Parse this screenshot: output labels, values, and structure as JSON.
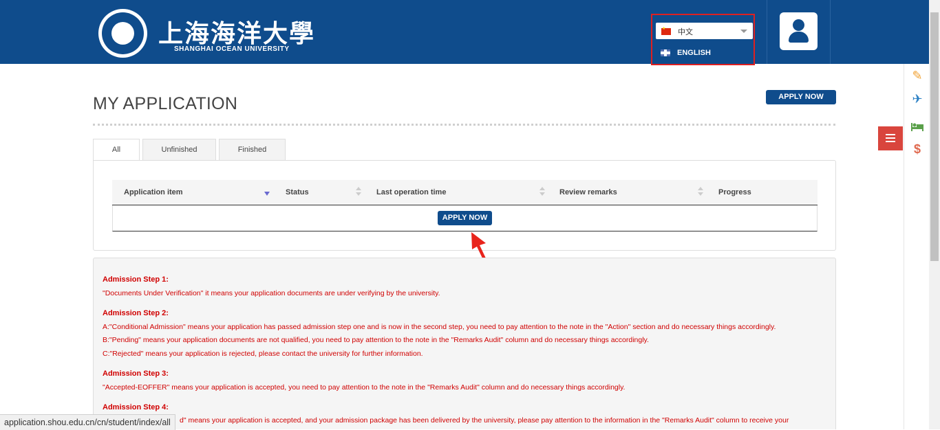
{
  "header": {
    "logo_cn": "上海海洋大學",
    "logo_en": "SHANGHAI OCEAN UNIVERSITY",
    "language": {
      "selected": "中文",
      "option": "ENGLISH"
    }
  },
  "page": {
    "title": "MY APPLICATION",
    "apply_now_label": "APPLY NOW"
  },
  "tabs": [
    {
      "label": "All",
      "active": true
    },
    {
      "label": "Unfinished",
      "active": false
    },
    {
      "label": "Finished",
      "active": false
    }
  ],
  "table": {
    "columns": [
      "Application item",
      "Status",
      "Last operation time",
      "Review remarks",
      "Progress"
    ],
    "empty_action_label": "APPLY NOW"
  },
  "info": {
    "steps": [
      {
        "title": "Admission Step 1:",
        "lines": [
          "\"Documents Under Verification\" it means your application documents are under verifying by the university."
        ]
      },
      {
        "title": "Admission Step 2:",
        "lines": [
          "A:\"Conditional Admission\" means your application has passed admission step one and is now in the second step, you need to pay attention to the note in the \"Action\" section and do necessary things accordingly.",
          "B:\"Pending\" means your application documents are not qualified, you need to pay attention to the note in the \"Remarks Audit\" column and do necessary things accordingly.",
          "C:\"Rejected\" means your application is rejected, please contact the university for further information."
        ]
      },
      {
        "title": "Admission Step 3:",
        "lines": [
          "\"Accepted-EOFFER\" means your application is accepted, you need to pay attention to the note in the \"Remarks Audit\" column and do necessary things accordingly."
        ]
      },
      {
        "title": "Admission Step 4:",
        "lines": [
          "d\" means your application is accepted, and your admission package has been delivered by the university, please pay attention to the information in the \"Remarks Audit\" column to receive your"
        ]
      }
    ]
  },
  "statusbar": {
    "url": "application.shou.edu.cn/cn/student/index/all"
  },
  "colors": {
    "header_bg": "#0f4c8c",
    "accent_red": "#d00000",
    "menu_red": "#d9453d"
  }
}
